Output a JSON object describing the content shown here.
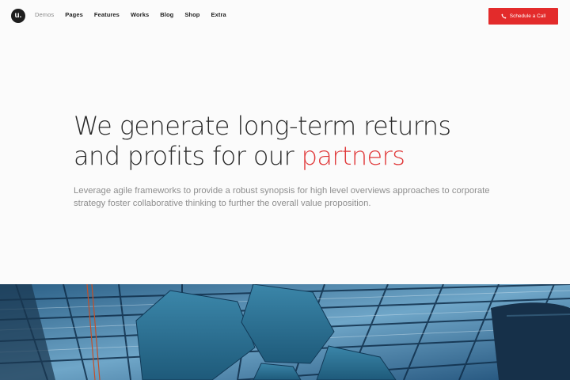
{
  "brand": {
    "logo_text": "u."
  },
  "nav": {
    "items": [
      {
        "label": "Demos",
        "active": true
      },
      {
        "label": "Pages",
        "active": false
      },
      {
        "label": "Features",
        "active": false
      },
      {
        "label": "Works",
        "active": false
      },
      {
        "label": "Blog",
        "active": false
      },
      {
        "label": "Shop",
        "active": false
      },
      {
        "label": "Extra",
        "active": false
      }
    ],
    "cta_label": "Schedule a Call",
    "cta_icon": "phone-icon"
  },
  "hero": {
    "title_line1": "We generate long-term returns",
    "title_line2_prefix": "and profits for our ",
    "title_accent": "partners",
    "subtitle": "Leverage agile frameworks to provide a robust synopsis for high level overviews approaches to corporate strategy foster collaborative thinking to further the overall value proposition."
  },
  "colors": {
    "accent": "#e32b2b",
    "background": "#fbfbfb",
    "text": "#2a2a2a",
    "muted": "#8e8e8e"
  },
  "banner": {
    "subject": "glass-roof-architecture-photo"
  }
}
